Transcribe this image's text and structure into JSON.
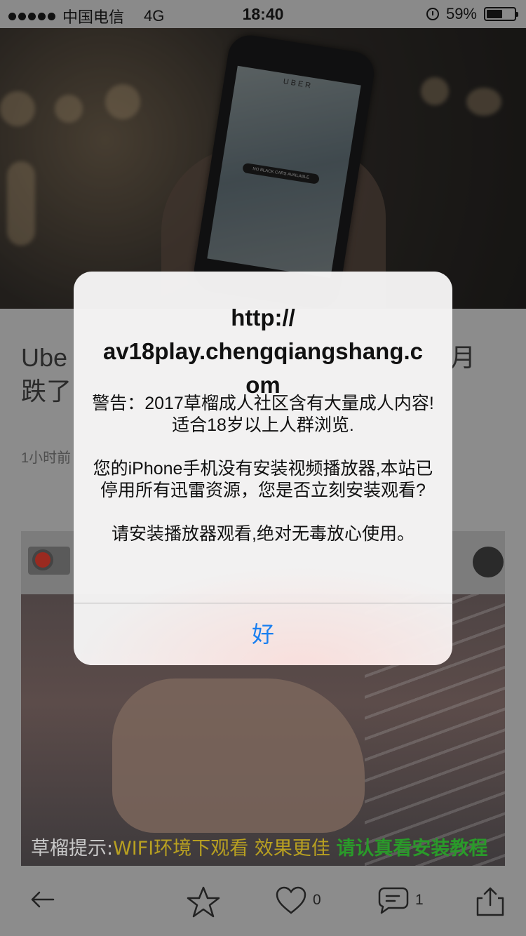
{
  "status_bar": {
    "carrier": "中国电信",
    "network": "4G",
    "time": "18:40",
    "battery_percent": "59%",
    "battery_level": 0.59
  },
  "hero": {
    "uber_wordmark": "UBER",
    "map_pill": "NO BLACK CARS AVAILABLE"
  },
  "article": {
    "title_left": "Ube",
    "title_right": "月",
    "title_line2": "跌了",
    "time_partial": "1小时前"
  },
  "ad": {
    "caption_part1": "草榴提示:",
    "caption_part2": "WIFI环境下观看",
    "caption_part3": " 效果更佳 ",
    "caption_part4": "请认真看安装教程"
  },
  "toolbar": {
    "like_count": "0",
    "comment_count": "1"
  },
  "alert": {
    "title": "http://\nav18play.chengqiangshang.com",
    "message": "警告：2017草榴成人社区含有大量成人内容!适合18岁以上人群浏览.\n\n您的iPhone手机没有安装视频播放器,本站已停用所有迅雷资源，您是否立刻安装观看?\n\n请安装播放器观看,绝对无毒放心使用。",
    "ok_label": "好"
  },
  "colors": {
    "alert_button": "#1a7ff0",
    "ad_caption_green": "#2a9a2a",
    "ad_caption_yellow": "#b8a021"
  }
}
